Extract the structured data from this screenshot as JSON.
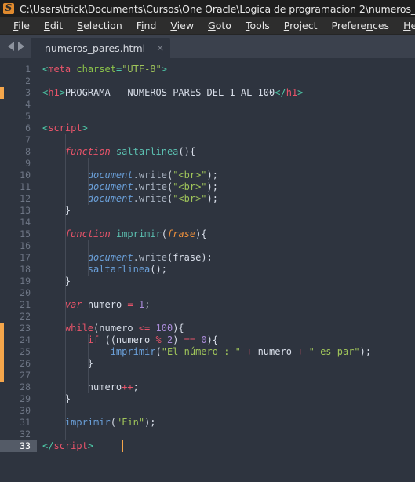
{
  "window": {
    "title": "C:\\Users\\trick\\Documents\\Cursos\\One Oracle\\Logica de programacion 2\\numeros_pares.html -",
    "logo_letter": "S"
  },
  "menubar": {
    "items": [
      {
        "label": "File",
        "accel_index": 0
      },
      {
        "label": "Edit",
        "accel_index": 0
      },
      {
        "label": "Selection",
        "accel_index": 0
      },
      {
        "label": "Find",
        "accel_index": 1
      },
      {
        "label": "View",
        "accel_index": 0
      },
      {
        "label": "Goto",
        "accel_index": 0
      },
      {
        "label": "Tools",
        "accel_index": 0
      },
      {
        "label": "Project",
        "accel_index": 0
      },
      {
        "label": "Preferences",
        "accel_index": 7
      },
      {
        "label": "Help",
        "accel_index": 0
      }
    ]
  },
  "tabbar": {
    "nav_prev": "previous-tab",
    "nav_next": "next-tab",
    "active_tab": "numeros_pares.html",
    "close_glyph": "×"
  },
  "editor": {
    "total_lines": 33,
    "active_line": 33,
    "caret_line": 33,
    "caret_column": 14,
    "modified_markers": [
      {
        "from_line": 3,
        "to_line": 3
      },
      {
        "from_line": 23,
        "to_line": 27
      }
    ],
    "colors": {
      "background": "#2e343f",
      "gutter_text": "#6d7584",
      "active_line_gutter": "#545b67",
      "caret": "#f5a64b",
      "marker": "#f5a64b",
      "tag": "#e8546a",
      "tag_punct": "#4ec9a8",
      "attribute": "#8bc34a",
      "string": "#9fc45a",
      "keyword": "#e8546a",
      "function_name": "#5bbfb0",
      "object": "#6a9fd8",
      "number": "#a98bd8",
      "parameter": "#f0913c",
      "text": "#d8dee9"
    },
    "lines": [
      {
        "n": 1,
        "tokens": [
          {
            "t": "<",
            "c": "punc"
          },
          {
            "t": "meta",
            "c": "tag"
          },
          {
            "t": " ",
            "c": "plain"
          },
          {
            "t": "charset",
            "c": "attr"
          },
          {
            "t": "=",
            "c": "punc"
          },
          {
            "t": "\"UTF-8\"",
            "c": "str"
          },
          {
            "t": ">",
            "c": "punc"
          }
        ],
        "indent": 1
      },
      {
        "n": 2,
        "tokens": [],
        "indent": 0
      },
      {
        "n": 3,
        "tokens": [
          {
            "t": "<",
            "c": "punc"
          },
          {
            "t": "h1",
            "c": "tag"
          },
          {
            "t": ">",
            "c": "punc"
          },
          {
            "t": "PROGRAMA - NUMEROS PARES DEL 1 AL 100",
            "c": "plain"
          },
          {
            "t": "</",
            "c": "punc"
          },
          {
            "t": "h1",
            "c": "tag"
          },
          {
            "t": ">",
            "c": "punc"
          }
        ],
        "indent": 1
      },
      {
        "n": 4,
        "tokens": [],
        "indent": 0
      },
      {
        "n": 5,
        "tokens": [],
        "indent": 0
      },
      {
        "n": 6,
        "tokens": [
          {
            "t": "<",
            "c": "punc"
          },
          {
            "t": "script",
            "c": "tag"
          },
          {
            "t": ">",
            "c": "punc"
          }
        ],
        "indent": 0
      },
      {
        "n": 7,
        "tokens": [],
        "indent": 0
      },
      {
        "n": 8,
        "tokens": [
          {
            "t": "    ",
            "c": "plain"
          },
          {
            "t": "function",
            "c": "kw"
          },
          {
            "t": " ",
            "c": "plain"
          },
          {
            "t": "saltarlinea",
            "c": "fn"
          },
          {
            "t": "(){",
            "c": "paren"
          }
        ],
        "indent": 0
      },
      {
        "n": 9,
        "tokens": [],
        "indent": 0
      },
      {
        "n": 10,
        "tokens": [
          {
            "t": "        ",
            "c": "plain"
          },
          {
            "t": "document",
            "c": "obj"
          },
          {
            "t": ".write",
            "c": "meth"
          },
          {
            "t": "(",
            "c": "paren"
          },
          {
            "t": "\"<br>\"",
            "c": "str"
          },
          {
            "t": ");",
            "c": "paren"
          }
        ],
        "indent": 0
      },
      {
        "n": 11,
        "tokens": [
          {
            "t": "        ",
            "c": "plain"
          },
          {
            "t": "document",
            "c": "obj"
          },
          {
            "t": ".write",
            "c": "meth"
          },
          {
            "t": "(",
            "c": "paren"
          },
          {
            "t": "\"<br>\"",
            "c": "str"
          },
          {
            "t": ");",
            "c": "paren"
          }
        ],
        "indent": 0
      },
      {
        "n": 12,
        "tokens": [
          {
            "t": "        ",
            "c": "plain"
          },
          {
            "t": "document",
            "c": "obj"
          },
          {
            "t": ".write",
            "c": "meth"
          },
          {
            "t": "(",
            "c": "paren"
          },
          {
            "t": "\"<br>\"",
            "c": "str"
          },
          {
            "t": ");",
            "c": "paren"
          }
        ],
        "indent": 0
      },
      {
        "n": 13,
        "tokens": [
          {
            "t": "    }",
            "c": "plain"
          }
        ],
        "indent": 0
      },
      {
        "n": 14,
        "tokens": [],
        "indent": 0
      },
      {
        "n": 15,
        "tokens": [
          {
            "t": "    ",
            "c": "plain"
          },
          {
            "t": "function",
            "c": "kw"
          },
          {
            "t": " ",
            "c": "plain"
          },
          {
            "t": "imprimir",
            "c": "fn"
          },
          {
            "t": "(",
            "c": "paren"
          },
          {
            "t": "frase",
            "c": "param"
          },
          {
            "t": "){",
            "c": "paren"
          }
        ],
        "indent": 0
      },
      {
        "n": 16,
        "tokens": [],
        "indent": 0
      },
      {
        "n": 17,
        "tokens": [
          {
            "t": "        ",
            "c": "plain"
          },
          {
            "t": "document",
            "c": "obj"
          },
          {
            "t": ".write",
            "c": "meth"
          },
          {
            "t": "(",
            "c": "paren"
          },
          {
            "t": "frase",
            "c": "plain"
          },
          {
            "t": ");",
            "c": "paren"
          }
        ],
        "indent": 0
      },
      {
        "n": 18,
        "tokens": [
          {
            "t": "        ",
            "c": "plain"
          },
          {
            "t": "saltarlinea",
            "c": "call"
          },
          {
            "t": "();",
            "c": "paren"
          }
        ],
        "indent": 0
      },
      {
        "n": 19,
        "tokens": [
          {
            "t": "    }",
            "c": "plain"
          }
        ],
        "indent": 0
      },
      {
        "n": 20,
        "tokens": [],
        "indent": 0
      },
      {
        "n": 21,
        "tokens": [
          {
            "t": "    ",
            "c": "plain"
          },
          {
            "t": "var",
            "c": "kw"
          },
          {
            "t": " numero ",
            "c": "plain"
          },
          {
            "t": "=",
            "c": "op"
          },
          {
            "t": " ",
            "c": "plain"
          },
          {
            "t": "1",
            "c": "num"
          },
          {
            "t": ";",
            "c": "plain"
          }
        ],
        "indent": 0
      },
      {
        "n": 22,
        "tokens": [],
        "indent": 0
      },
      {
        "n": 23,
        "tokens": [
          {
            "t": "    ",
            "c": "plain"
          },
          {
            "t": "while",
            "c": "kw2"
          },
          {
            "t": "(numero ",
            "c": "paren"
          },
          {
            "t": "<=",
            "c": "op"
          },
          {
            "t": " ",
            "c": "plain"
          },
          {
            "t": "100",
            "c": "num"
          },
          {
            "t": "){",
            "c": "paren"
          }
        ],
        "indent": 0
      },
      {
        "n": 24,
        "tokens": [
          {
            "t": "        ",
            "c": "plain"
          },
          {
            "t": "if",
            "c": "kw2"
          },
          {
            "t": " ((numero ",
            "c": "paren"
          },
          {
            "t": "%",
            "c": "op"
          },
          {
            "t": " ",
            "c": "plain"
          },
          {
            "t": "2",
            "c": "num"
          },
          {
            "t": ") ",
            "c": "paren"
          },
          {
            "t": "==",
            "c": "op"
          },
          {
            "t": " ",
            "c": "plain"
          },
          {
            "t": "0",
            "c": "num"
          },
          {
            "t": "){",
            "c": "paren"
          }
        ],
        "indent": 0
      },
      {
        "n": 25,
        "tokens": [
          {
            "t": "            ",
            "c": "plain"
          },
          {
            "t": "imprimir",
            "c": "call"
          },
          {
            "t": "(",
            "c": "paren"
          },
          {
            "t": "\"El número : \"",
            "c": "str"
          },
          {
            "t": " ",
            "c": "plain"
          },
          {
            "t": "+",
            "c": "op"
          },
          {
            "t": " numero ",
            "c": "plain"
          },
          {
            "t": "+",
            "c": "op"
          },
          {
            "t": " ",
            "c": "plain"
          },
          {
            "t": "\" es par\"",
            "c": "str"
          },
          {
            "t": ");",
            "c": "paren"
          }
        ],
        "indent": 0
      },
      {
        "n": 26,
        "tokens": [
          {
            "t": "        }",
            "c": "plain"
          }
        ],
        "indent": 0
      },
      {
        "n": 27,
        "tokens": [],
        "indent": 0
      },
      {
        "n": 28,
        "tokens": [
          {
            "t": "        numero",
            "c": "plain"
          },
          {
            "t": "++",
            "c": "op"
          },
          {
            "t": ";",
            "c": "plain"
          }
        ],
        "indent": 0
      },
      {
        "n": 29,
        "tokens": [
          {
            "t": "    }",
            "c": "plain"
          }
        ],
        "indent": 0
      },
      {
        "n": 30,
        "tokens": [],
        "indent": 0
      },
      {
        "n": 31,
        "tokens": [
          {
            "t": "    ",
            "c": "plain"
          },
          {
            "t": "imprimir",
            "c": "call"
          },
          {
            "t": "(",
            "c": "paren"
          },
          {
            "t": "\"Fin\"",
            "c": "str"
          },
          {
            "t": ");",
            "c": "paren"
          }
        ],
        "indent": 0
      },
      {
        "n": 32,
        "tokens": [],
        "indent": 0
      },
      {
        "n": 33,
        "tokens": [
          {
            "t": "</",
            "c": "punc"
          },
          {
            "t": "script",
            "c": "tag"
          },
          {
            "t": ">",
            "c": "punc"
          }
        ],
        "indent": 0
      }
    ]
  }
}
